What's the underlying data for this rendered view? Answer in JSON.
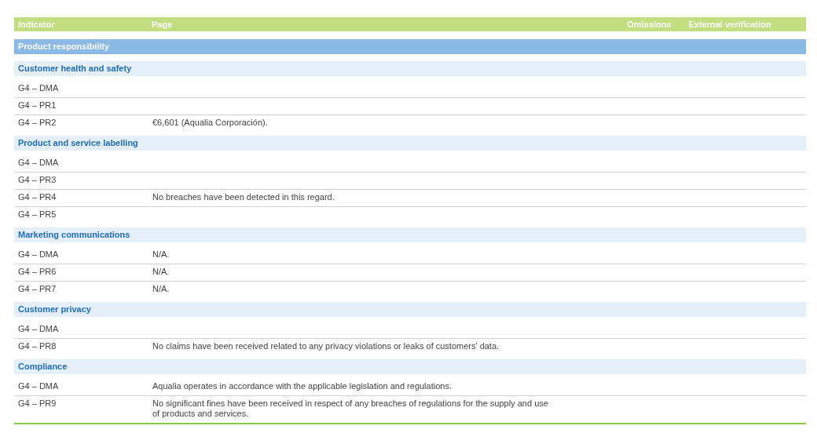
{
  "table": {
    "columns": [
      "Indicator",
      "Page",
      "Omissions",
      "External verification"
    ],
    "section": "Product responsibility",
    "groups": [
      {
        "title": "Customer health and safety",
        "rows": [
          {
            "indicator": "G4 – DMA"
          },
          {
            "indicator": "G4 – PR1"
          },
          {
            "indicator": "G4 – PR2",
            "page": "€6,601 (Aqualia Corporación)."
          }
        ]
      },
      {
        "title": "Product and service labelling",
        "rows": [
          {
            "indicator": "G4 – DMA"
          },
          {
            "indicator": "G4 – PR3"
          },
          {
            "indicator": "G4 – PR4",
            "page": "No breaches have been detected in this regard."
          },
          {
            "indicator": "G4 – PR5"
          }
        ]
      },
      {
        "title": "Marketing communications",
        "rows": [
          {
            "indicator": "G4 – DMA",
            "page": "N/A."
          },
          {
            "indicator": "G4 – PR6",
            "page": "N/A."
          },
          {
            "indicator": "G4 – PR7",
            "page": "N/A."
          }
        ]
      },
      {
        "title": "Customer privacy",
        "rows": [
          {
            "indicator": "G4 – DMA"
          },
          {
            "indicator": "G4 – PR8",
            "page": "No claims have been received related to any privacy violations or leaks of customers' data."
          }
        ]
      },
      {
        "title": "Compliance",
        "rows": [
          {
            "indicator": "G4 – DMA",
            "page": "Aqualia operates in accordance with the applicable legislation and regulations."
          },
          {
            "indicator": "G4 – PR9",
            "page": "No significant fines have been received in respect of any breaches of regulations for the supply and use of products and services."
          }
        ]
      }
    ]
  }
}
